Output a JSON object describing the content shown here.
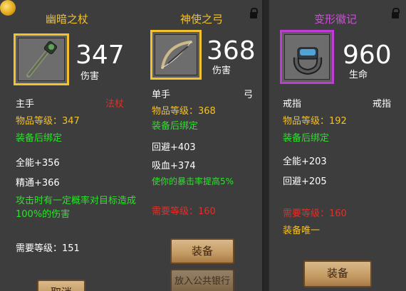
{
  "items": {
    "staff": {
      "name": "幽暗之杖",
      "icon": "staff-icon",
      "stat_value": "347",
      "stat_label": "伤害",
      "slot": "主手",
      "type": "法杖",
      "item_level": "物品等级：347",
      "bind": "装备后绑定",
      "stats": [
        "全能+356",
        "精通+366"
      ],
      "effect": "攻击时有一定概率对目标造成100%的伤害",
      "required_level": "需要等级：151",
      "bottom_button": "取消"
    },
    "bow": {
      "name": "神使之弓",
      "icon": "bow-icon",
      "stat_value": "368",
      "stat_label": "伤害",
      "slot": "单手",
      "type": "弓",
      "item_level": "物品等级：368",
      "bind": "装备后绑定",
      "stats": [
        "回避+403",
        "吸血+374"
      ],
      "effect": "使你的暴击率提高5%",
      "required_level": "需要等级：160",
      "equip_button": "装备",
      "bank_button": "放入公共银行"
    },
    "ring": {
      "name": "变形徽记",
      "icon": "ring-icon",
      "stat_value": "960",
      "stat_label": "生命",
      "slot": "戒指",
      "type": "戒指",
      "item_level": "物品等级：192",
      "bind": "装备后绑定",
      "stats": [
        "全能+203",
        "回避+205"
      ],
      "required_level": "需要等级：160",
      "unique": "装备唯一",
      "equip_button": "装备"
    }
  },
  "colors": {
    "gold": "#f2c12e",
    "purple": "#d24be0",
    "green": "#2ee02e",
    "red": "#e0302a",
    "panel": "#3d3d3d"
  }
}
